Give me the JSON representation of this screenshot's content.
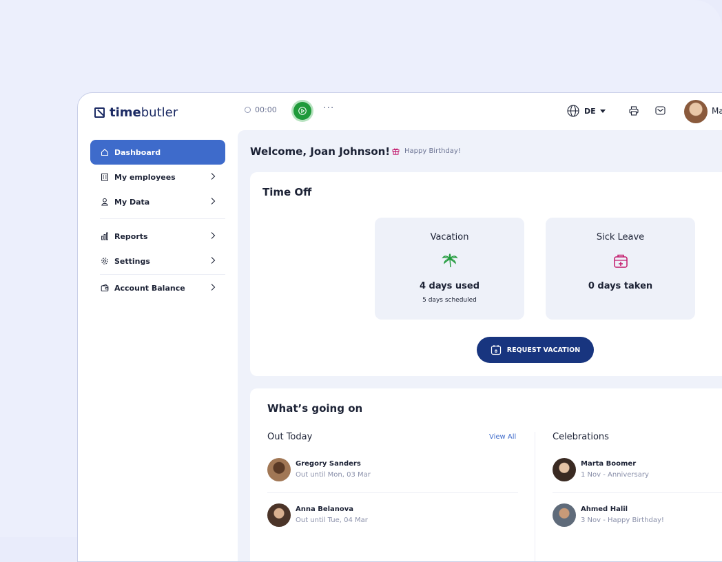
{
  "brand": {
    "name_bold": "time",
    "name_light": "butler"
  },
  "topbar": {
    "timer": "00:00",
    "more": "···",
    "language": "DE",
    "user_name": "Ma"
  },
  "sidebar": {
    "items": [
      {
        "label": "Dashboard",
        "icon": "home-icon"
      },
      {
        "label": "My employees",
        "icon": "building-icon"
      },
      {
        "label": "My Data",
        "icon": "user-icon"
      },
      {
        "label": "Reports",
        "icon": "bar-chart-icon"
      },
      {
        "label": "Settings",
        "icon": "gear-icon"
      },
      {
        "label": "Account Balance",
        "icon": "wallet-icon"
      }
    ]
  },
  "main": {
    "welcome": "Welcome, Joan Johnson!",
    "birthday": "Happy Birthday!",
    "time_off": {
      "title": "Time Off",
      "vacation": {
        "title": "Vacation",
        "main": "4 days used",
        "sub": "5 days scheduled"
      },
      "sick": {
        "title": "Sick Leave",
        "main": "0 days taken"
      },
      "request_button": "REQUEST VACATION"
    },
    "going_on": {
      "title": "What’s going on",
      "out_today": {
        "title": "Out Today",
        "view_all": "View All",
        "people": [
          {
            "name": "Gregory Sanders",
            "detail": "Out until Mon, 03 Mar"
          },
          {
            "name": "Anna Belanova",
            "detail": "Out until Tue, 04 Mar"
          }
        ]
      },
      "celebrations": {
        "title": "Celebrations",
        "people": [
          {
            "name": "Marta Boomer",
            "detail": "1 Nov - Anniversary"
          },
          {
            "name": "Ahmed Halil",
            "detail": "3 Nov - Happy Birthday!"
          }
        ]
      }
    }
  },
  "colors": {
    "accent": "#3e6bcb",
    "primary_button": "#18357f",
    "play_green": "#1f9a3a",
    "vacation_icon": "#1f9a3a",
    "sick_icon": "#c2186b"
  }
}
